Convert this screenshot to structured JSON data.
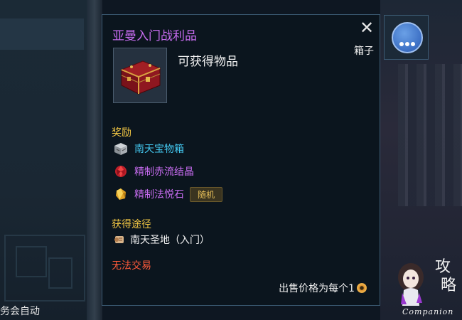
{
  "background": {
    "left_text": "务会自动"
  },
  "tooltip": {
    "title": "亚曼入门战利品",
    "category": "箱子",
    "description": "可获得物品",
    "rewards_heading": "奖励",
    "rewards": [
      {
        "name": "南天宝物箱",
        "color": "#43c7ef",
        "icon": "box-icon"
      },
      {
        "name": "精制赤流结晶",
        "color": "#c76cf0",
        "icon": "red-crystal-icon"
      },
      {
        "name": "精制法悦石",
        "color": "#c76cf0",
        "icon": "gold-stone-icon",
        "badge": "随机"
      }
    ],
    "source_heading": "获得途径",
    "source": "南天圣地（入门）",
    "trade_status": "无法交易",
    "sell_text": "出售价格为每个1"
  },
  "companion": {
    "label": "Companion"
  }
}
